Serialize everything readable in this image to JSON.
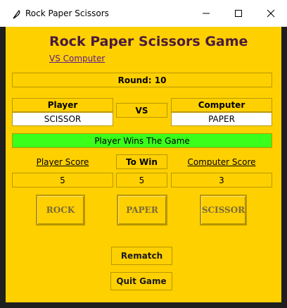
{
  "window": {
    "title": "Rock Paper Scissors",
    "icon": "feather-icon"
  },
  "header": {
    "title": "Rock Paper Scissors Game",
    "mode_link": "VS Computer"
  },
  "round": {
    "label": "Round: 10"
  },
  "player": {
    "label": "Player",
    "choice": "SCISSOR"
  },
  "vs": {
    "label": "VS"
  },
  "computer": {
    "label": "Computer",
    "choice": "PAPER"
  },
  "result": {
    "text": "Player Wins The Game",
    "color": "#39ff1a"
  },
  "scores": {
    "player_label": "Player Score",
    "to_win_label": "To Win",
    "computer_label": "Computer Score",
    "player_value": "5",
    "to_win_value": "5",
    "computer_value": "3"
  },
  "choices": {
    "rock": "ROCK",
    "paper": "PAPER",
    "scissor": "SCISSOR"
  },
  "actions": {
    "rematch": "Rematch",
    "quit": "Quit Game"
  },
  "colors": {
    "background": "#ffd000",
    "heading": "#4a1a3f",
    "link": "#5a1a8c"
  }
}
